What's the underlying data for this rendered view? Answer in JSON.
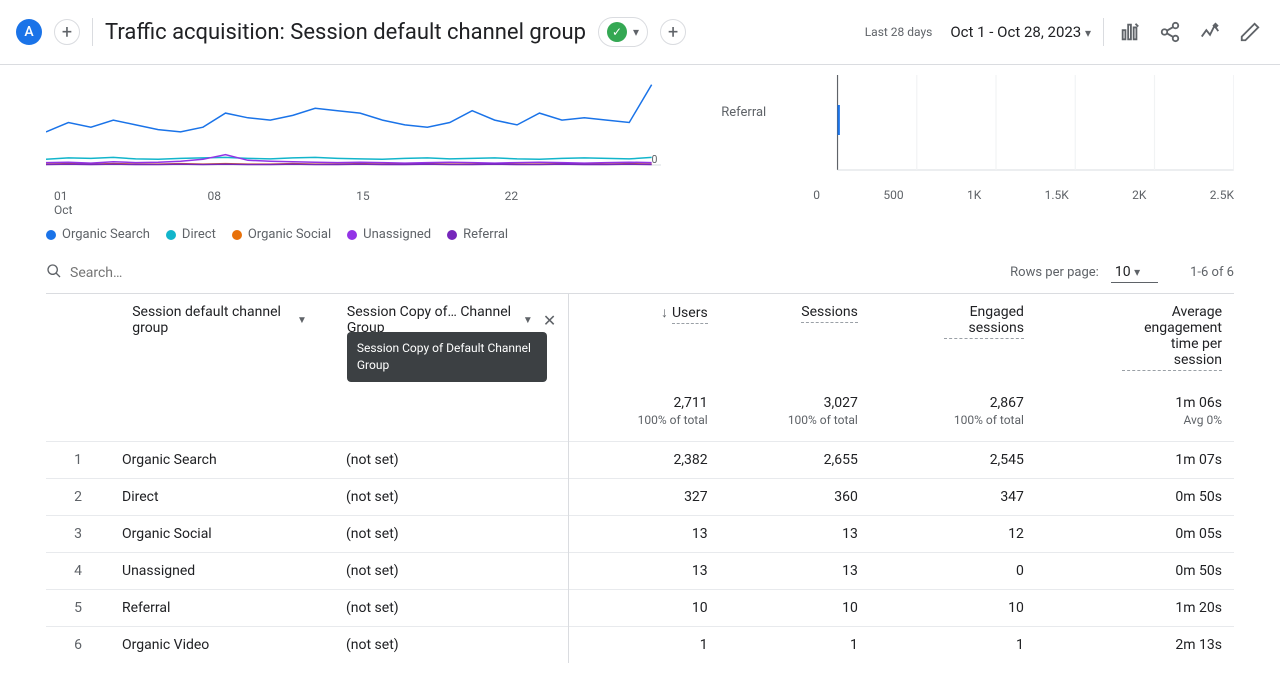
{
  "header": {
    "avatar_initial": "A",
    "title": "Traffic acquisition: Session default channel group",
    "date_label": "Last 28 days",
    "date_range": "Oct 1 - Oct 28, 2023"
  },
  "chart_data": {
    "line": {
      "type": "line",
      "x_ticks": [
        "01\nOct",
        "08",
        "15",
        "22"
      ],
      "y_tick": "0",
      "ylim": [
        0,
        180
      ],
      "series": [
        {
          "name": "Organic Search",
          "color": "#1a73e8",
          "values": [
            70,
            90,
            80,
            95,
            85,
            75,
            70,
            80,
            110,
            100,
            95,
            105,
            120,
            115,
            110,
            95,
            85,
            80,
            90,
            115,
            95,
            85,
            110,
            95,
            100,
            95,
            90,
            170
          ]
        },
        {
          "name": "Direct",
          "color": "#12b5cb",
          "values": [
            12,
            15,
            14,
            16,
            13,
            12,
            14,
            15,
            16,
            14,
            13,
            15,
            16,
            14,
            13,
            12,
            14,
            15,
            13,
            14,
            15,
            13,
            12,
            14,
            15,
            14,
            13,
            16
          ]
        },
        {
          "name": "Organic Social",
          "color": "#e8710a",
          "values": [
            2,
            3,
            2,
            3,
            2,
            2,
            3,
            2,
            3,
            2,
            2,
            3,
            2,
            2,
            3,
            2,
            2,
            3,
            2,
            2,
            3,
            2,
            2,
            3,
            2,
            2,
            3,
            2
          ]
        },
        {
          "name": "Unassigned",
          "color": "#9334e6",
          "values": [
            5,
            6,
            4,
            7,
            5,
            6,
            8,
            12,
            22,
            10,
            8,
            7,
            6,
            5,
            6,
            5,
            4,
            5,
            6,
            5,
            4,
            5,
            6,
            5,
            4,
            5,
            6,
            5
          ]
        },
        {
          "name": "Referral",
          "color": "#7627bb",
          "values": [
            1,
            2,
            1,
            2,
            1,
            1,
            2,
            1,
            2,
            1,
            1,
            2,
            1,
            1,
            2,
            1,
            1,
            2,
            1,
            1,
            2,
            1,
            1,
            2,
            1,
            1,
            2,
            1
          ]
        }
      ]
    },
    "bar": {
      "type": "bar",
      "categories": [
        "Referral"
      ],
      "values": [
        10
      ],
      "xlim_ticks": [
        "0",
        "500",
        "1K",
        "1.5K",
        "2K",
        "2.5K"
      ],
      "xlim": [
        0,
        2500
      ]
    }
  },
  "legend": [
    {
      "label": "Organic Search",
      "color": "#1a73e8"
    },
    {
      "label": "Direct",
      "color": "#12b5cb"
    },
    {
      "label": "Organic Social",
      "color": "#e8710a"
    },
    {
      "label": "Unassigned",
      "color": "#9334e6"
    },
    {
      "label": "Referral",
      "color": "#7627bb"
    }
  ],
  "search_placeholder": "Search…",
  "rows_per_page_label": "Rows per page:",
  "rows_per_page_value": "10",
  "page_info": "1-6 of 6",
  "dimensions": {
    "primary": "Session default channel group",
    "secondary": "Session Copy of… Channel Group",
    "tooltip": "Session Copy of Default Channel Group"
  },
  "columns": {
    "users": "Users",
    "sessions": "Sessions",
    "engaged_sessions": "Engaged sessions",
    "avg_engagement": "Average engagement time per session"
  },
  "totals": {
    "users": {
      "value": "2,711",
      "sub": "100% of total"
    },
    "sessions": {
      "value": "3,027",
      "sub": "100% of total"
    },
    "engaged_sessions": {
      "value": "2,867",
      "sub": "100% of total"
    },
    "avg_engagement": {
      "value": "1m 06s",
      "sub": "Avg 0%"
    }
  },
  "rows": [
    {
      "n": "1",
      "dim1": "Organic Search",
      "dim2": "(not set)",
      "users": "2,382",
      "sessions": "2,655",
      "engaged": "2,545",
      "avg": "1m 07s"
    },
    {
      "n": "2",
      "dim1": "Direct",
      "dim2": "(not set)",
      "users": "327",
      "sessions": "360",
      "engaged": "347",
      "avg": "0m 50s"
    },
    {
      "n": "3",
      "dim1": "Organic Social",
      "dim2": "(not set)",
      "users": "13",
      "sessions": "13",
      "engaged": "12",
      "avg": "0m 05s"
    },
    {
      "n": "4",
      "dim1": "Unassigned",
      "dim2": "(not set)",
      "users": "13",
      "sessions": "13",
      "engaged": "0",
      "avg": "0m 50s"
    },
    {
      "n": "5",
      "dim1": "Referral",
      "dim2": "(not set)",
      "users": "10",
      "sessions": "10",
      "engaged": "10",
      "avg": "1m 20s"
    },
    {
      "n": "6",
      "dim1": "Organic Video",
      "dim2": "(not set)",
      "users": "1",
      "sessions": "1",
      "engaged": "1",
      "avg": "2m 13s"
    }
  ]
}
